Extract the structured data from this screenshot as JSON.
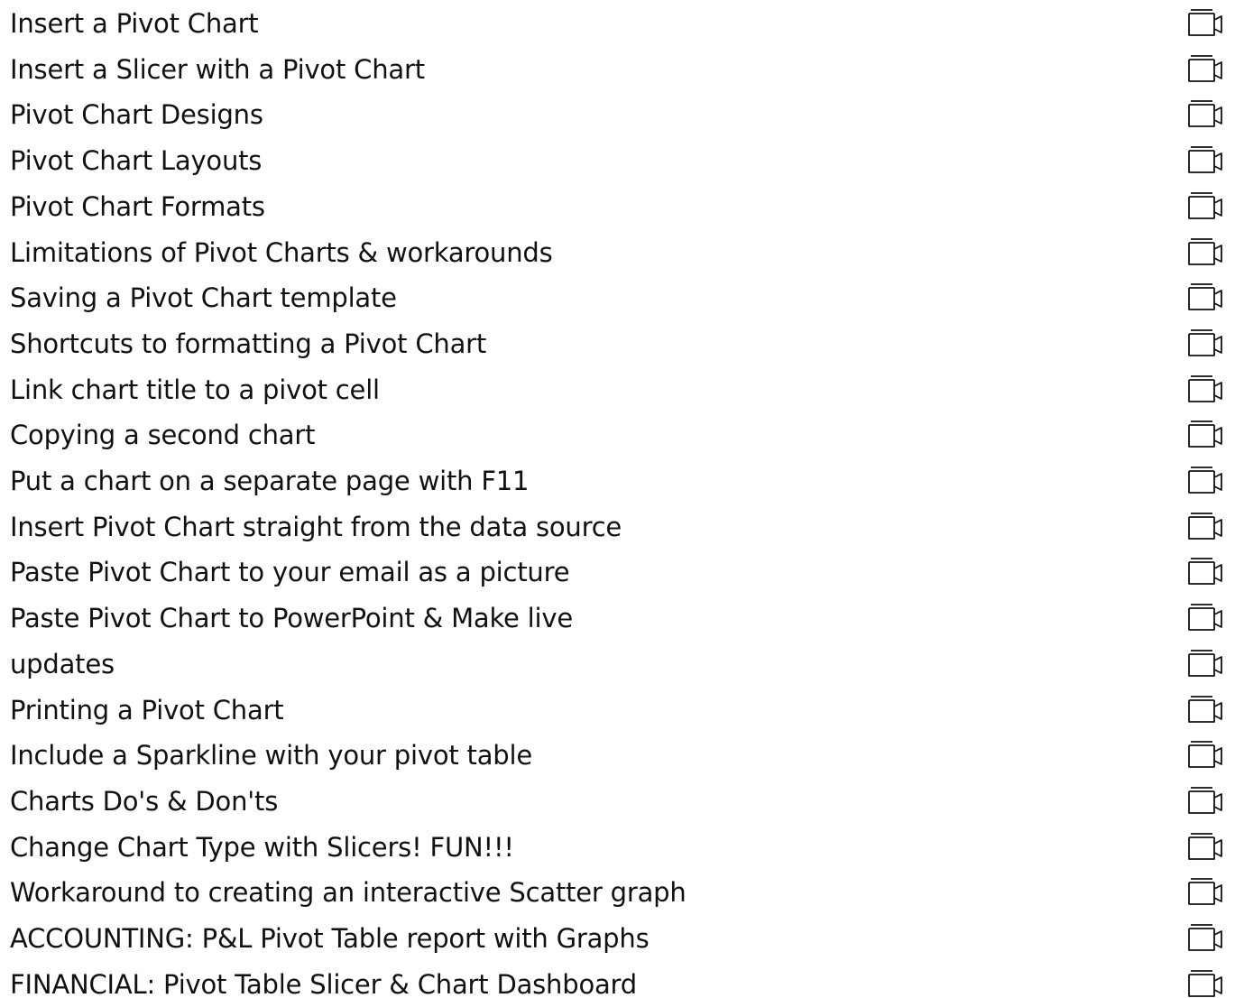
{
  "lectures": [
    {
      "title": "Insert a Pivot Chart",
      "icon": "video-icon"
    },
    {
      "title": "Insert a Slicer with a Pivot Chart",
      "icon": "video-icon"
    },
    {
      "title": "Pivot Chart Designs",
      "icon": "video-icon"
    },
    {
      "title": "Pivot Chart Layouts",
      "icon": "video-icon"
    },
    {
      "title": "Pivot Chart Formats",
      "icon": "video-icon"
    },
    {
      "title": "Limitations of Pivot Charts & workarounds",
      "icon": "video-icon"
    },
    {
      "title": "Saving a Pivot Chart template",
      "icon": "video-icon"
    },
    {
      "title": "Shortcuts to formatting a Pivot Chart",
      "icon": "video-icon"
    },
    {
      "title": "Link chart title to a pivot cell",
      "icon": "video-icon"
    },
    {
      "title": "Copying a second chart",
      "icon": "video-icon"
    },
    {
      "title": "Put a chart on a separate page with F11",
      "icon": "video-icon"
    },
    {
      "title": "Insert Pivot Chart straight from the data source",
      "icon": "video-icon"
    },
    {
      "title": "Paste Pivot Chart to your email as a picture",
      "icon": "video-icon"
    },
    {
      "title": "Paste Pivot Chart to PowerPoint & Make live",
      "icon": "video-icon"
    },
    {
      "title": "updates",
      "icon": "video-icon"
    },
    {
      "title": "Printing a Pivot Chart",
      "icon": "video-icon"
    },
    {
      "title": "Include a Sparkline with your pivot table",
      "icon": "video-icon"
    },
    {
      "title": "Charts Do's & Don'ts",
      "icon": "video-icon"
    },
    {
      "title": "Change Chart Type with Slicers! FUN!!!",
      "icon": "video-icon"
    },
    {
      "title": "Workaround to creating an interactive Scatter graph",
      "icon": "video-icon"
    },
    {
      "title": "ACCOUNTING: P&L Pivot Table report with Graphs",
      "icon": "video-icon"
    },
    {
      "title": "FINANCIAL: Pivot Table Slicer & Chart Dashboard",
      "icon": "video-icon"
    }
  ]
}
